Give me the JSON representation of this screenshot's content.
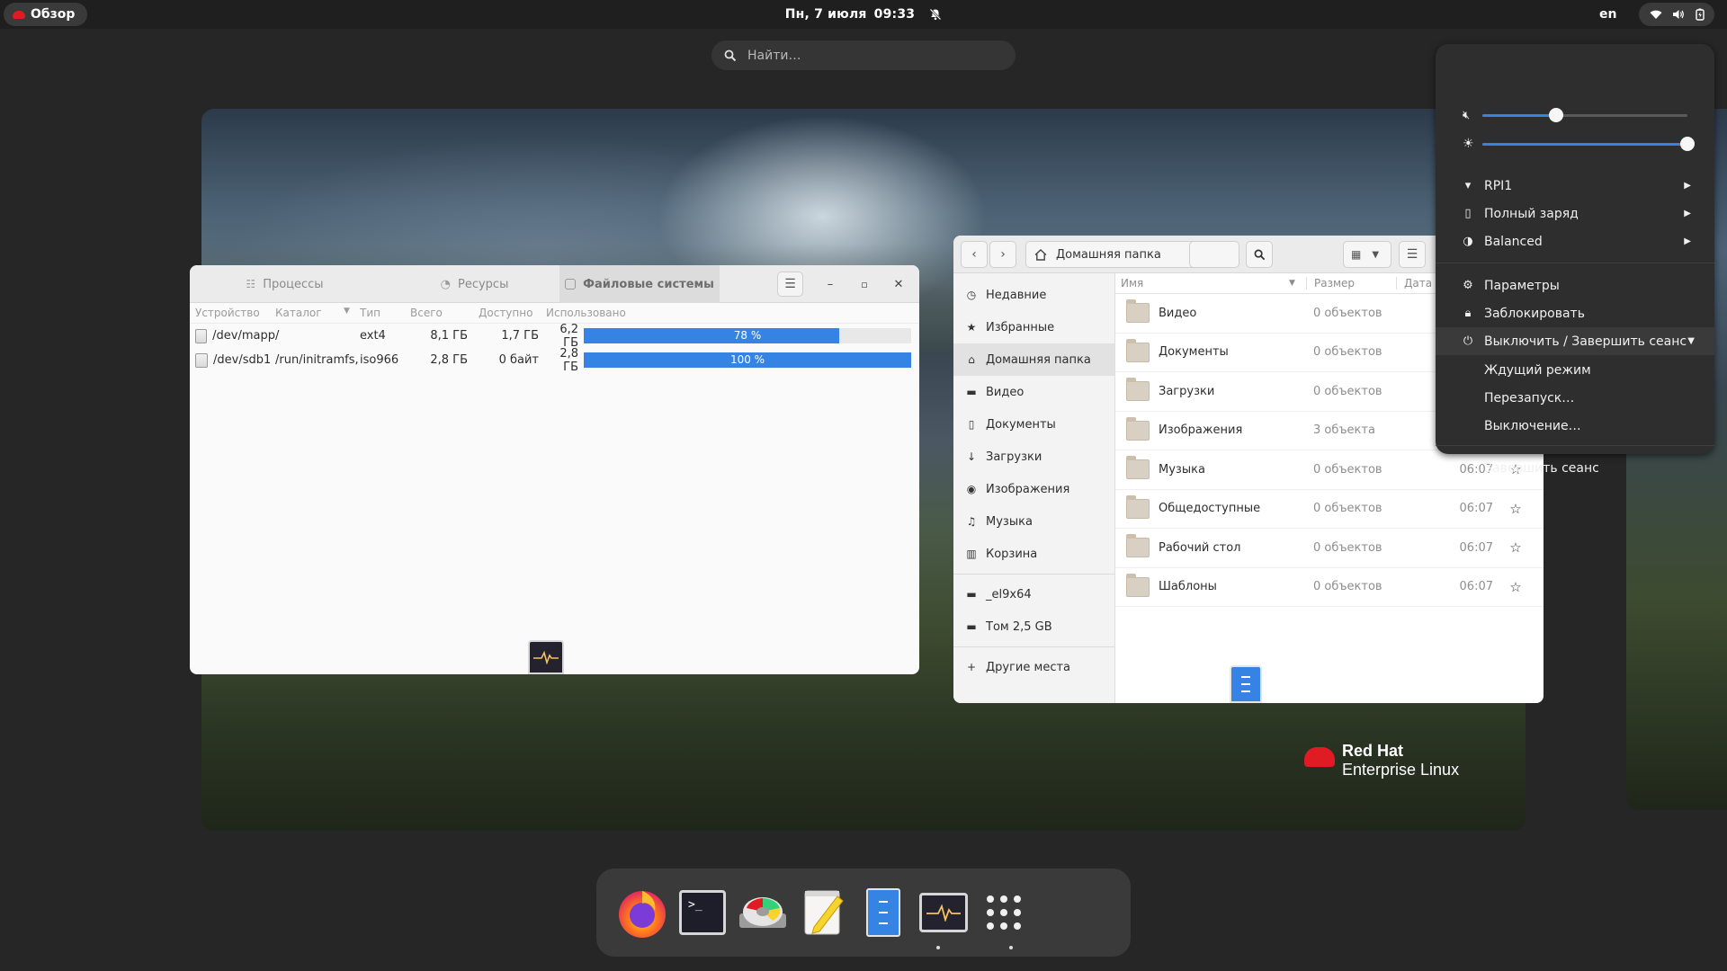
{
  "topbar": {
    "overview_label": "Обзор",
    "date": "Пн, 7 июля",
    "time": "09:33",
    "language": "en"
  },
  "search": {
    "placeholder": "Найти…"
  },
  "wallpaper": {
    "logo_line1": "Red Hat",
    "logo_line2": "Enterprise Linux"
  },
  "system_monitor": {
    "tabs": [
      "Процессы",
      "Ресурсы",
      "Файловые системы"
    ],
    "active_tab": "Файловые системы",
    "columns": [
      "Устройство",
      "Каталог",
      "Тип",
      "Всего",
      "Доступно",
      "Использовано"
    ],
    "rows": [
      {
        "device": "/dev/mapp",
        "dir": "/",
        "type": "ext4",
        "total": "8,1 ГБ",
        "available": "1,7 ГБ",
        "used": "6,2 ГБ",
        "percent_label": "78 %",
        "percent": 78
      },
      {
        "device": "/dev/sdb1",
        "dir": "/run/initramfs,",
        "type": "iso966",
        "total": "2,8 ГБ",
        "available": "0 байт",
        "used": "2,8 ГБ",
        "percent_label": "100 %",
        "percent": 100
      }
    ]
  },
  "files": {
    "location": "Домашняя папка",
    "sidebar": [
      {
        "label": "Недавние",
        "icon": "clock-icon"
      },
      {
        "label": "Избранные",
        "icon": "star-icon"
      },
      {
        "label": "Домашняя папка",
        "icon": "home-icon"
      },
      {
        "label": "Видео",
        "icon": "video-icon"
      },
      {
        "label": "Документы",
        "icon": "document-icon"
      },
      {
        "label": "Загрузки",
        "icon": "download-icon"
      },
      {
        "label": "Изображения",
        "icon": "camera-icon"
      },
      {
        "label": "Музыка",
        "icon": "music-icon"
      },
      {
        "label": "Корзина",
        "icon": "trash-icon"
      }
    ],
    "devices": [
      {
        "label": "_el9x64",
        "icon": "drive-icon"
      },
      {
        "label": "Том 2,5 GB",
        "icon": "drive-icon"
      }
    ],
    "other_places": "Другие места",
    "columns": {
      "name": "Имя",
      "size": "Размер",
      "date": "Дата"
    },
    "rows": [
      {
        "name": "Видео",
        "size": "0 объектов",
        "date": ""
      },
      {
        "name": "Документы",
        "size": "0 объектов",
        "date": ""
      },
      {
        "name": "Загрузки",
        "size": "0 объектов",
        "date": ""
      },
      {
        "name": "Изображения",
        "size": "3 объекта",
        "date": ""
      },
      {
        "name": "Музыка",
        "size": "0 объектов",
        "date": "06:07"
      },
      {
        "name": "Общедоступные",
        "size": "0 объектов",
        "date": "06:07"
      },
      {
        "name": "Рабочий стол",
        "size": "0 объектов",
        "date": "06:07"
      },
      {
        "name": "Шаблоны",
        "size": "0 объектов",
        "date": "06:07"
      }
    ]
  },
  "quick_settings": {
    "volume_level": 0.36,
    "brightness_level": 1.0,
    "wifi": "RPI1",
    "battery": "Полный заряд",
    "power_mode": "Balanced",
    "settings": "Параметры",
    "lock": "Заблокировать",
    "power_off_logout": "Выключить / Завершить сеанс",
    "suspend": "Ждущий режим",
    "restart": "Перезапуск…",
    "power_off": "Выключение…",
    "logout": "Завершить сеанс"
  },
  "dash": {
    "apps": [
      "firefox-icon",
      "terminal-icon",
      "disk-usage-icon",
      "text-editor-icon",
      "files-icon",
      "system-monitor-icon",
      "app-grid-icon"
    ],
    "colors": {
      "accent": "#3584e4",
      "redhat": "#e01b24"
    }
  }
}
